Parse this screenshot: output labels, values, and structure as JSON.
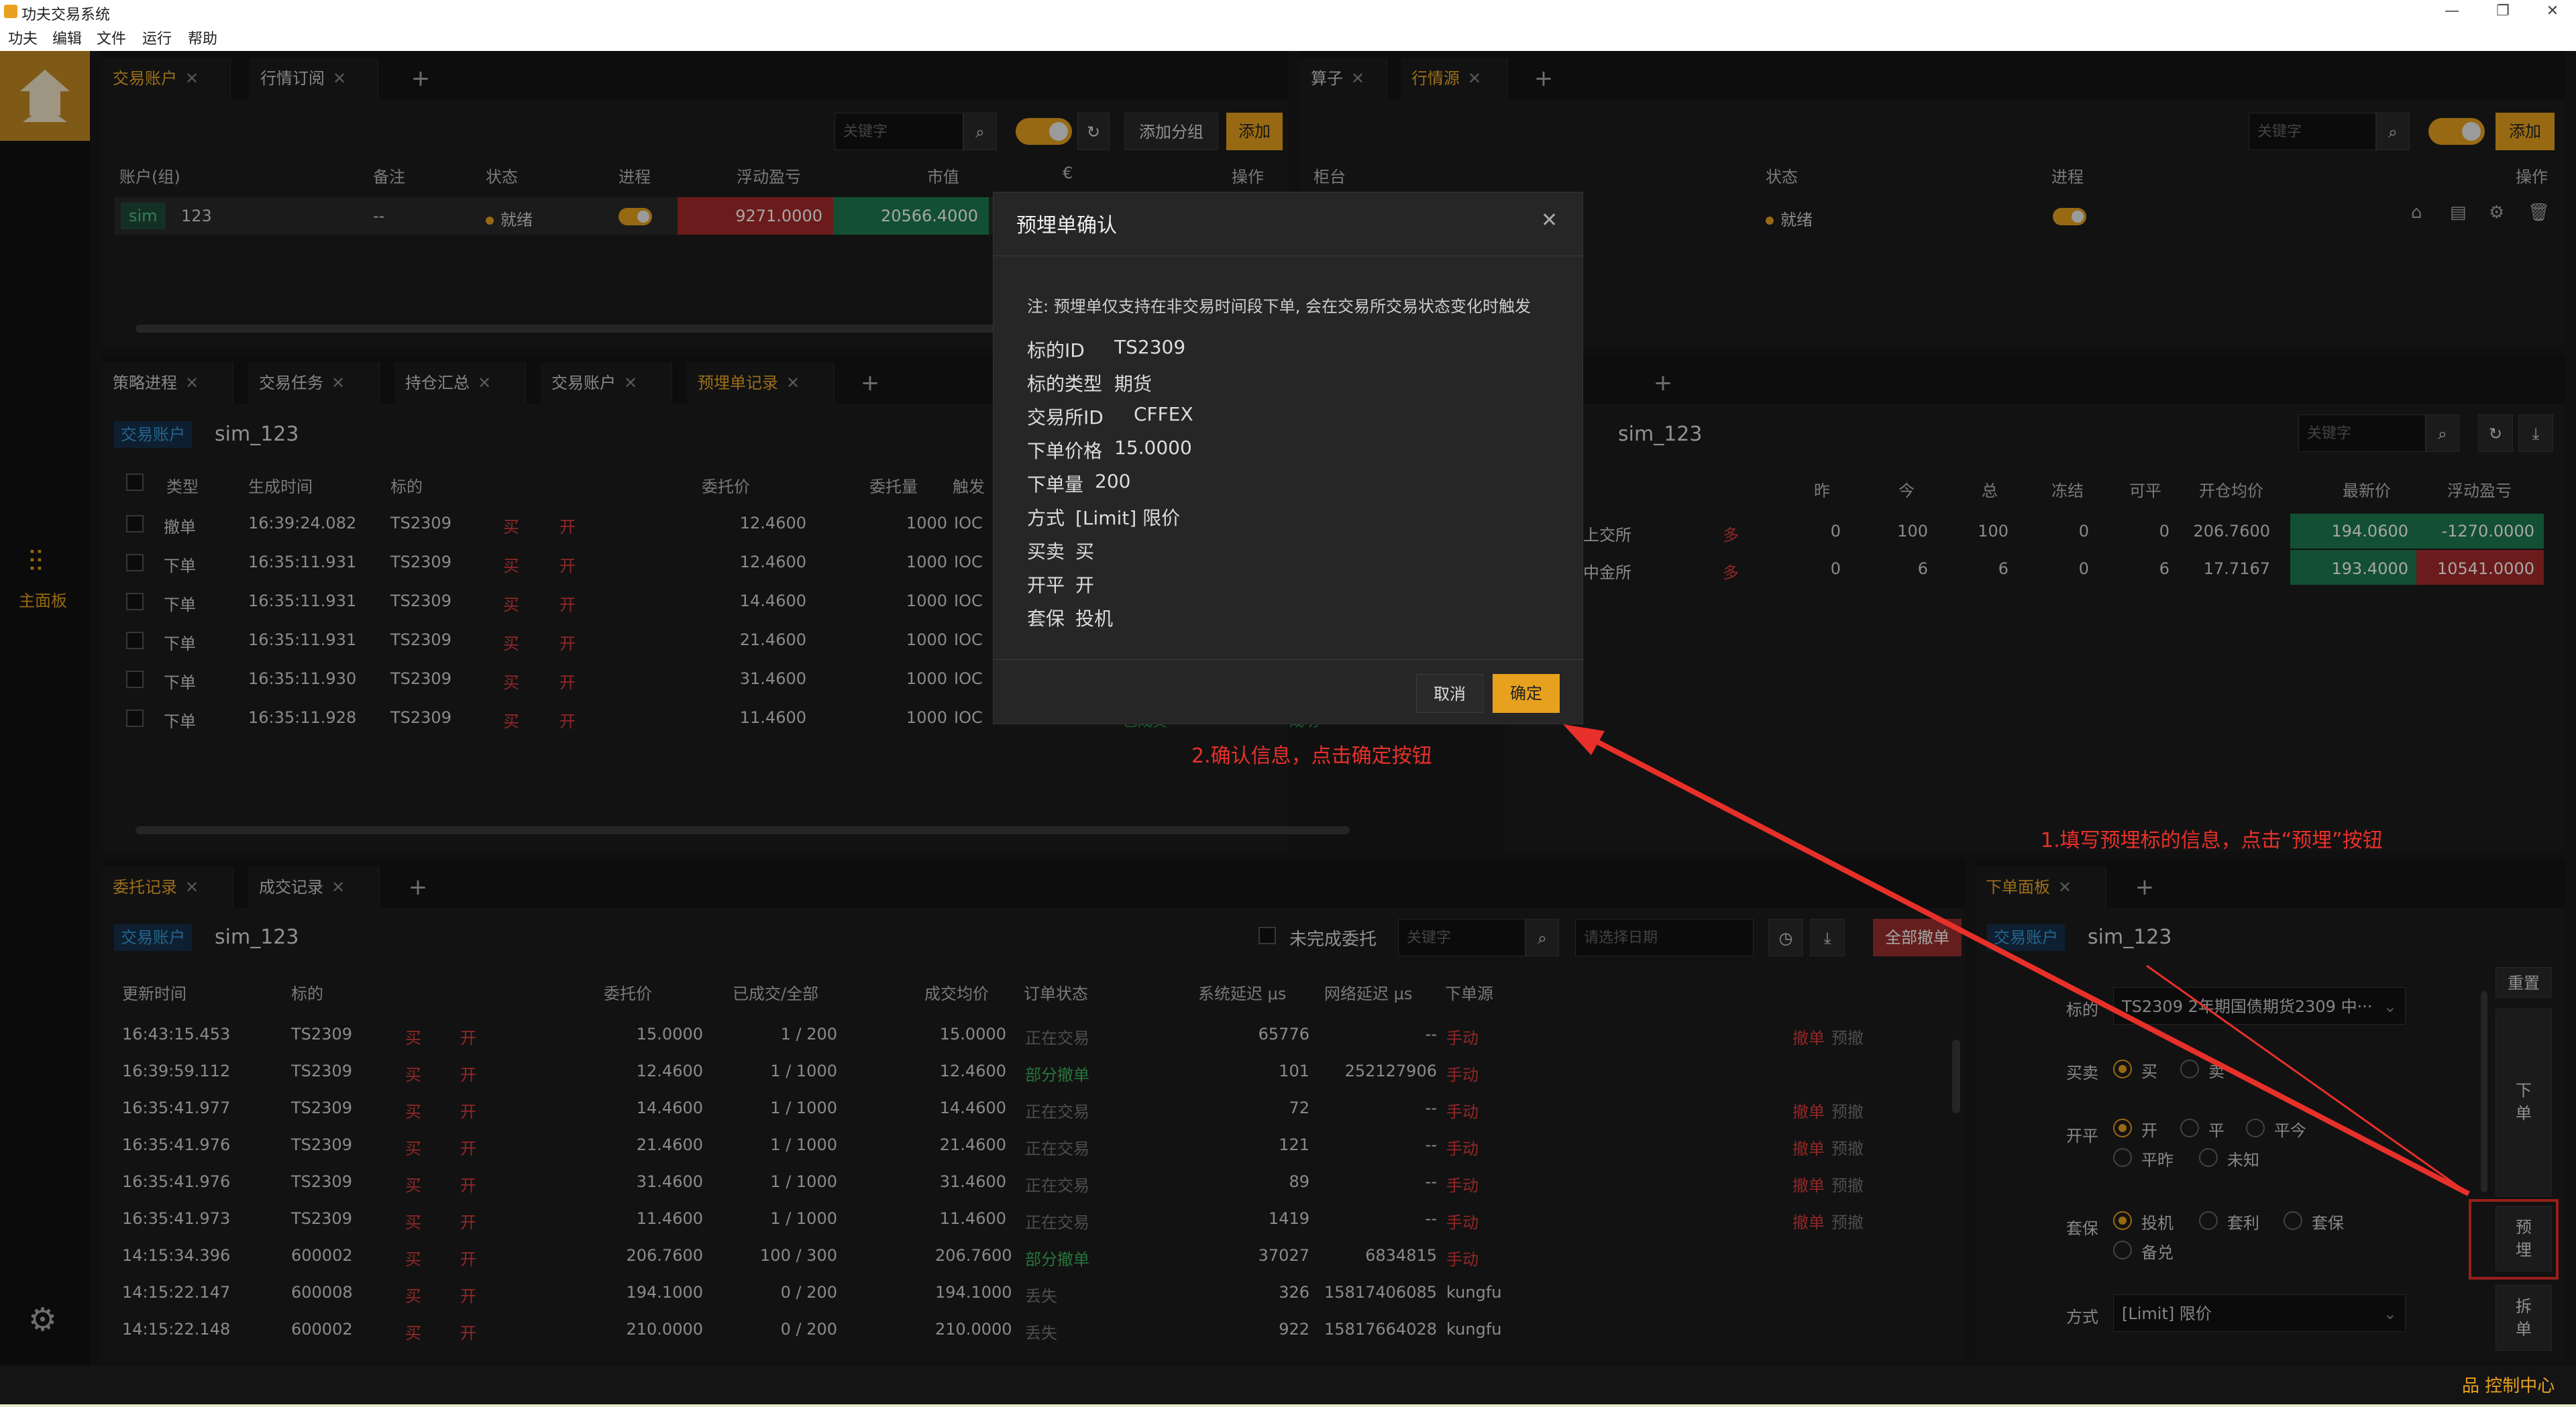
{
  "app": {
    "title": "功夫交易系统",
    "menu": [
      "功夫",
      "编辑",
      "文件",
      "运行",
      "帮助"
    ],
    "win_buttons": [
      "—",
      "❐",
      "✕"
    ]
  },
  "left_nav": {
    "main_label": "主面板"
  },
  "top_left": {
    "tabs": [
      "交易账户",
      "行情订阅"
    ],
    "search_placeholder": "关键字",
    "add_group": "添加分组",
    "add": "添加",
    "headers": [
      "账户(组)",
      "备注",
      "状态",
      "进程",
      "浮动盈亏",
      "市值",
      "€",
      "操作"
    ],
    "row": {
      "tag": "sim",
      "account": "123",
      "note": "--",
      "status": "就绪",
      "pnl": "9271.0000",
      "value": "20566.4000"
    }
  },
  "top_right": {
    "tabs": [
      "算子",
      "行情源"
    ],
    "search_placeholder": "关键字",
    "add": "添加",
    "headers": [
      "柜台",
      "状态",
      "进程",
      "操作"
    ],
    "row": {
      "status": "就绪"
    }
  },
  "mid_left": {
    "tabs": [
      "策略进程",
      "交易任务",
      "持仓汇总",
      "交易账户",
      "预埋单记录"
    ],
    "badge": "交易账户",
    "account": "sim_123",
    "headers": [
      "类型",
      "生成时间",
      "标的",
      "委托价",
      "委托量",
      "触发"
    ],
    "rows": [
      {
        "type": "撤单",
        "time": "16:39:24.082",
        "sym": "TS2309",
        "side": "买",
        "oc": "开",
        "price": "12.4600",
        "qty": "1000",
        "cond": "IOC"
      },
      {
        "type": "下单",
        "time": "16:35:11.931",
        "sym": "TS2309",
        "side": "买",
        "oc": "开",
        "price": "12.4600",
        "qty": "1000",
        "cond": "IOC"
      },
      {
        "type": "下单",
        "time": "16:35:11.931",
        "sym": "TS2309",
        "side": "买",
        "oc": "开",
        "price": "14.4600",
        "qty": "1000",
        "cond": "IOC"
      },
      {
        "type": "下单",
        "time": "16:35:11.931",
        "sym": "TS2309",
        "side": "买",
        "oc": "开",
        "price": "21.4600",
        "qty": "1000",
        "cond": "IOC"
      },
      {
        "type": "下单",
        "time": "16:35:11.930",
        "sym": "TS2309",
        "side": "买",
        "oc": "开",
        "price": "31.4600",
        "qty": "1000",
        "cond": "IOC"
      },
      {
        "type": "下单",
        "time": "16:35:11.928",
        "sym": "TS2309",
        "side": "买",
        "oc": "开",
        "price": "11.4600",
        "qty": "1000",
        "cond": "IOC"
      }
    ],
    "hidden_a": "已成交",
    "hidden_b": "成功"
  },
  "mid_right": {
    "account": "sim_123",
    "search_placeholder": "关键字",
    "headers": [
      "昨",
      "今",
      "总",
      "冻结",
      "可平",
      "开仓均价",
      "最新价",
      "浮动盈亏"
    ],
    "rows": [
      {
        "exch": "上交所",
        "dir": "多",
        "y": "0",
        "t": "100",
        "tot": "100",
        "f": "0",
        "c": "0",
        "avg": "206.7600",
        "last": "194.0600",
        "pnl": "-1270.0000"
      },
      {
        "exch": "中金所",
        "dir": "多",
        "y": "0",
        "t": "6",
        "tot": "6",
        "f": "0",
        "c": "6",
        "avg": "17.7167",
        "last": "193.4000",
        "pnl": "10541.0000"
      }
    ]
  },
  "bottom_left": {
    "tabs": [
      "委托记录",
      "成交记录"
    ],
    "badge": "交易账户",
    "account": "sim_123",
    "unfinished": "未完成委托",
    "search_placeholder": "关键字",
    "date_placeholder": "请选择日期",
    "cancel_all": "全部撤单",
    "headers": [
      "更新时间",
      "标的",
      "委托价",
      "已成交/全部",
      "成交均价",
      "订单状态",
      "系统延迟 μs",
      "网络延迟 μs",
      "下单源"
    ],
    "rows": [
      {
        "time": "16:43:15.453",
        "sym": "TS2309",
        "side": "买",
        "oc": "开",
        "price": "15.0000",
        "fill": "1 / 200",
        "avg": "15.0000",
        "status": "正在交易",
        "sc": "gray",
        "sys": "65776",
        "net": "--",
        "src": "手动",
        "srcc": "red",
        "a1": "撤单",
        "a2": "预撤"
      },
      {
        "time": "16:39:59.112",
        "sym": "TS2309",
        "side": "买",
        "oc": "开",
        "price": "12.4600",
        "fill": "1 / 1000",
        "avg": "12.4600",
        "status": "部分撤单",
        "sc": "green",
        "sys": "101",
        "net": "252127906",
        "src": "手动",
        "srcc": "red",
        "a1": "",
        "a2": ""
      },
      {
        "time": "16:35:41.977",
        "sym": "TS2309",
        "side": "买",
        "oc": "开",
        "price": "14.4600",
        "fill": "1 / 1000",
        "avg": "14.4600",
        "status": "正在交易",
        "sc": "gray",
        "sys": "72",
        "net": "--",
        "src": "手动",
        "srcc": "red",
        "a1": "撤单",
        "a2": "预撤"
      },
      {
        "time": "16:35:41.976",
        "sym": "TS2309",
        "side": "买",
        "oc": "开",
        "price": "21.4600",
        "fill": "1 / 1000",
        "avg": "21.4600",
        "status": "正在交易",
        "sc": "gray",
        "sys": "121",
        "net": "--",
        "src": "手动",
        "srcc": "red",
        "a1": "撤单",
        "a2": "预撤"
      },
      {
        "time": "16:35:41.976",
        "sym": "TS2309",
        "side": "买",
        "oc": "开",
        "price": "31.4600",
        "fill": "1 / 1000",
        "avg": "31.4600",
        "status": "正在交易",
        "sc": "gray",
        "sys": "89",
        "net": "--",
        "src": "手动",
        "srcc": "red",
        "a1": "撤单",
        "a2": "预撤"
      },
      {
        "time": "16:35:41.973",
        "sym": "TS2309",
        "side": "买",
        "oc": "开",
        "price": "11.4600",
        "fill": "1 / 1000",
        "avg": "11.4600",
        "status": "正在交易",
        "sc": "gray",
        "sys": "1419",
        "net": "--",
        "src": "手动",
        "srcc": "red",
        "a1": "撤单",
        "a2": "预撤"
      },
      {
        "time": "14:15:34.396",
        "sym": "600002",
        "side": "买",
        "oc": "开",
        "price": "206.7600",
        "fill": "100 / 300",
        "avg": "206.7600",
        "status": "部分撤单",
        "sc": "green",
        "sys": "37027",
        "net": "6834815",
        "src": "手动",
        "srcc": "red",
        "a1": "",
        "a2": ""
      },
      {
        "time": "14:15:22.147",
        "sym": "600008",
        "side": "买",
        "oc": "开",
        "price": "194.1000",
        "fill": "0 / 200",
        "avg": "194.1000",
        "status": "丢失",
        "sc": "gray",
        "sys": "326",
        "net": "15817406085",
        "src": "kungfu",
        "srcc": "plain",
        "a1": "",
        "a2": ""
      },
      {
        "time": "14:15:22.148",
        "sym": "600002",
        "side": "买",
        "oc": "开",
        "price": "210.0000",
        "fill": "0 / 200",
        "avg": "210.0000",
        "status": "丢失",
        "sc": "gray",
        "sys": "922",
        "net": "15817664028",
        "src": "kungfu",
        "srcc": "plain",
        "a1": "",
        "a2": ""
      }
    ]
  },
  "order_panel": {
    "tab": "下单面板",
    "badge": "交易账户",
    "account": "sim_123",
    "instrument_label": "标的",
    "instrument_value": "TS2309 2年期国债期货2309 中···",
    "side_label": "买卖",
    "side_buy": "买",
    "side_sell": "卖",
    "oc_label": "开平",
    "oc_opts": [
      "开",
      "平",
      "平今",
      "平昨",
      "未知"
    ],
    "hedge_label": "套保",
    "hedge_opts": [
      "投机",
      "套利",
      "套保",
      "备兑"
    ],
    "method_label": "方式",
    "method_value": "[Limit] 限价",
    "btn_reset": "重置",
    "btn_order_1": "下",
    "btn_order_2": "单",
    "btn_pre_1": "预",
    "btn_pre_2": "埋",
    "btn_split_1": "拆",
    "btn_split_2": "单"
  },
  "status_bar": {
    "control": "控制中心"
  },
  "dialog": {
    "title": "预埋单确认",
    "note": "注: 预埋单仅支持在非交易时间段下单, 会在交易所交易状态变化时触发",
    "fields": [
      {
        "k": "标的ID",
        "v": "TS2309",
        "c": "plain"
      },
      {
        "k": "标的类型",
        "v": "期货",
        "c": "red"
      },
      {
        "k": "交易所ID",
        "v": "CFFEX",
        "c": "plain"
      },
      {
        "k": "下单价格",
        "v": "15.0000",
        "c": "plain"
      },
      {
        "k": "下单量",
        "v": "200",
        "c": "plain"
      },
      {
        "k": "方式",
        "v": "[Limit] 限价",
        "c": "plain"
      },
      {
        "k": "买卖",
        "v": "买",
        "c": "red"
      },
      {
        "k": "开平",
        "v": "开",
        "c": "red"
      },
      {
        "k": "套保",
        "v": "投机",
        "c": "plain"
      }
    ],
    "cancel": "取消",
    "confirm": "确定"
  },
  "annotations": {
    "step1": "1.填写预埋标的信息，点击“预埋”按钮",
    "step2": "2.确认信息，点击确定按钮"
  }
}
